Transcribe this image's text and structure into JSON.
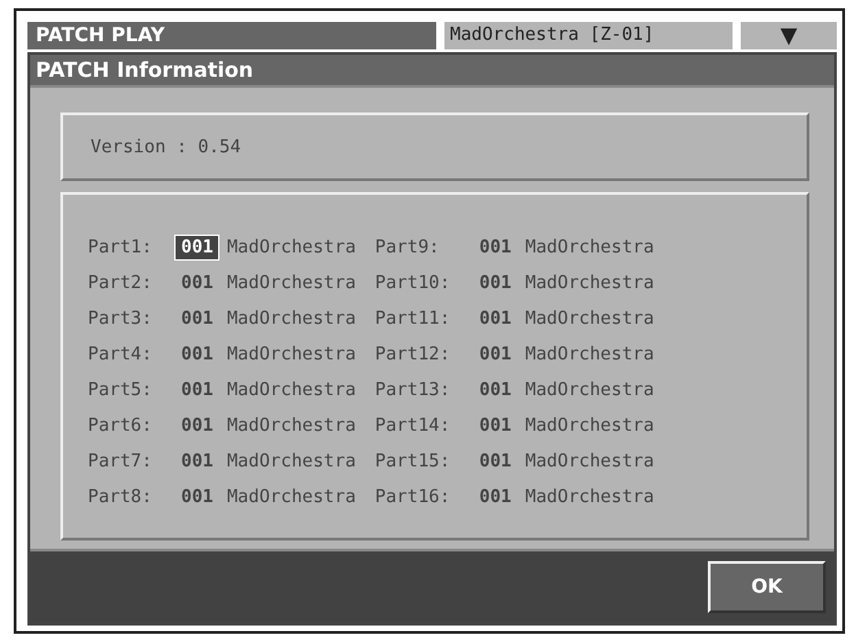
{
  "header": {
    "title": "PATCH PLAY",
    "patch_name": "MadOrchestra [Z-01]",
    "dropdown": "▼"
  },
  "dialog": {
    "title": "PATCH Information",
    "version": "Version : 0.54",
    "parts": [
      {
        "label": "Part1:",
        "number": "001",
        "name": "MadOrchestra",
        "selected": true
      },
      {
        "label": "Part2:",
        "number": "001",
        "name": "MadOrchestra",
        "selected": false
      },
      {
        "label": "Part3:",
        "number": "001",
        "name": "MadOrchestra",
        "selected": false
      },
      {
        "label": "Part4:",
        "number": "001",
        "name": "MadOrchestra",
        "selected": false
      },
      {
        "label": "Part5:",
        "number": "001",
        "name": "MadOrchestra",
        "selected": false
      },
      {
        "label": "Part6:",
        "number": "001",
        "name": "MadOrchestra",
        "selected": false
      },
      {
        "label": "Part7:",
        "number": "001",
        "name": "MadOrchestra",
        "selected": false
      },
      {
        "label": "Part8:",
        "number": "001",
        "name": "MadOrchestra",
        "selected": false
      },
      {
        "label": "Part9:",
        "number": "001",
        "name": "MadOrchestra",
        "selected": false
      },
      {
        "label": "Part10:",
        "number": "001",
        "name": "MadOrchestra",
        "selected": false
      },
      {
        "label": "Part11:",
        "number": "001",
        "name": "MadOrchestra",
        "selected": false
      },
      {
        "label": "Part12:",
        "number": "001",
        "name": "MadOrchestra",
        "selected": false
      },
      {
        "label": "Part13:",
        "number": "001",
        "name": "MadOrchestra",
        "selected": false
      },
      {
        "label": "Part14:",
        "number": "001",
        "name": "MadOrchestra",
        "selected": false
      },
      {
        "label": "Part15:",
        "number": "001",
        "name": "MadOrchestra",
        "selected": false
      },
      {
        "label": "Part16:",
        "number": "001",
        "name": "MadOrchestra",
        "selected": false
      }
    ],
    "ok_button": "OK"
  }
}
